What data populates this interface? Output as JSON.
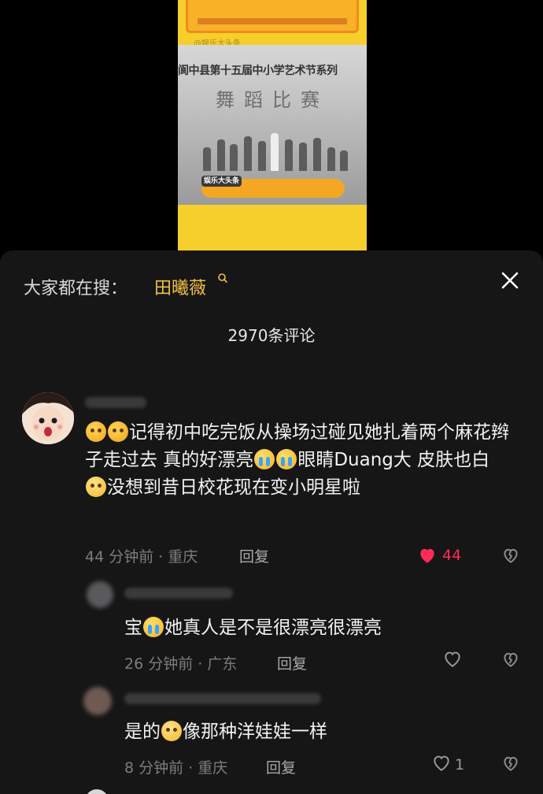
{
  "video": {
    "watermark": "@娱乐大头条",
    "stage_banner_line1": "阆中县第十五届中小学艺术节系列",
    "stage_banner_line2": "舞蹈比赛",
    "caption_tag": "娱乐大头条"
  },
  "search": {
    "prefix": "大家都在搜：",
    "term": "田曦薇"
  },
  "comment_count": "2970条评论",
  "comments": [
    {
      "text_segments": [
        "记得初中吃完饭从操场过碰见她扎着两个麻花辫子走过去 真的好漂亮",
        "眼睛Duang大 皮肤也白",
        "没想到昔日校花现在变小明星啦"
      ],
      "time_location": "44 分钟前 · 重庆",
      "reply_label": "回复",
      "like_count": "44",
      "liked": true
    }
  ],
  "replies": [
    {
      "text_segments": [
        "宝",
        "她真人是不是很漂亮很漂亮"
      ],
      "time_location": "26 分钟前 · 广东",
      "reply_label": "回复",
      "like_count": ""
    },
    {
      "text_segments": [
        "是的",
        "像那种洋娃娃一样"
      ],
      "time_location": "8 分钟前 · 重庆",
      "reply_label": "回复",
      "like_count": "1"
    }
  ],
  "colors": {
    "sheet_bg": "#161617",
    "search_term": "#f3c240",
    "like_active": "#fe2c55",
    "meta_text": "#7d7d80"
  },
  "icons": [
    "search-icon",
    "close-icon",
    "heart-icon",
    "dislike-icon",
    "shy-emoji",
    "cry-emoji",
    "pleading-emoji"
  ]
}
